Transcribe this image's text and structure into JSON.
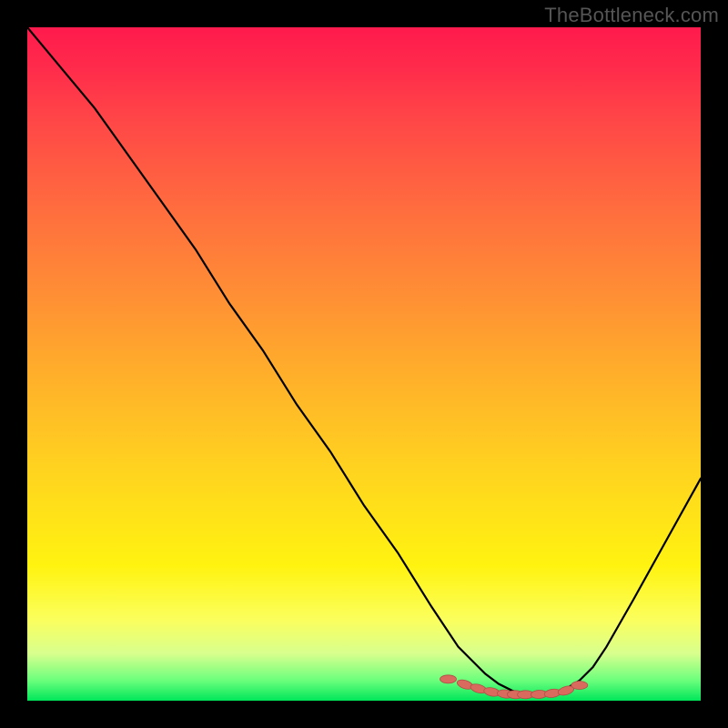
{
  "watermark": "TheBottleneck.com",
  "chart_data": {
    "type": "line",
    "title": "",
    "xlabel": "",
    "ylabel": "",
    "x_range": [
      0,
      100
    ],
    "y_range": [
      0,
      100
    ],
    "series": [
      {
        "name": "bottleneck-curve",
        "x": [
          0,
          5,
          10,
          15,
          20,
          25,
          30,
          35,
          40,
          45,
          50,
          55,
          60,
          62,
          64,
          66,
          68,
          70,
          72,
          74,
          76,
          78,
          80,
          82,
          84,
          86,
          90,
          95,
          100
        ],
        "values": [
          100,
          94,
          88,
          81,
          74,
          67,
          59,
          52,
          44,
          37,
          29,
          22,
          14,
          11,
          8,
          6,
          4,
          2.5,
          1.5,
          1,
          1,
          1.2,
          1.8,
          3,
          5,
          8,
          15,
          24,
          33
        ]
      }
    ],
    "markers": {
      "name": "optimal-band",
      "x": [
        62.5,
        65,
        67,
        69,
        71,
        72.5,
        74,
        76,
        78,
        80,
        82
      ],
      "values": [
        3.2,
        2.4,
        1.8,
        1.3,
        1.0,
        0.9,
        0.9,
        0.95,
        1.1,
        1.5,
        2.3
      ]
    },
    "background_gradient": {
      "top": "#ff1a4d",
      "mid": "#ffd41f",
      "bottom": "#00e65a"
    }
  }
}
